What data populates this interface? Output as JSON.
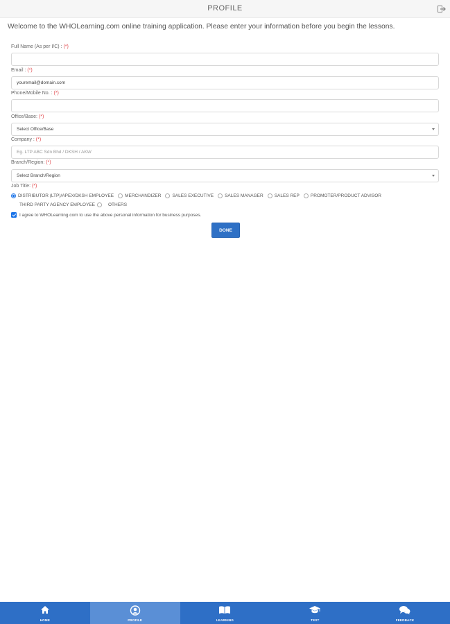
{
  "header": {
    "title": "PROFILE"
  },
  "welcome": "Welcome to the WHOLearning.com online training application. Please enter your information before you begin the lessons.",
  "form": {
    "fullname": {
      "label": "Full Name (As per I/C) : ",
      "req": "(*)",
      "value": ""
    },
    "email": {
      "label": "Email : ",
      "req": "(*)",
      "value": "youremail@domain.com"
    },
    "phone": {
      "label": "Phone/Mobile No. : ",
      "req": "(*)",
      "value": ""
    },
    "office": {
      "label": "Office/Base: ",
      "req": "(*)",
      "selected": "Select Office/Base"
    },
    "company": {
      "label": "Company : ",
      "req": "(*)",
      "placeholder": "Eg. LTP ABC Sdn Bhd / DKSH / AKW"
    },
    "branch": {
      "label": "Branch/Region: ",
      "req": "(*)",
      "selected": "Select Branch/Region"
    },
    "jobtitle": {
      "label": "Job Title: ",
      "req": "(*)",
      "options": [
        "DISTRIBUTOR (LTP)/APEX/DKSH EMPLOYEE",
        "MERCHANDIZER",
        "SALES EXECUTIVE",
        "SALES MANAGER",
        "SALES REP",
        "PROMOTER/PRODUCT ADVISOR",
        "THIRD PARTY AGENCY EMPLOYEE",
        "OTHERS"
      ],
      "selected_index": 0
    },
    "agree": {
      "label": "I agree to WHOLearning.com to use the above personal information for business purposes.",
      "checked": true
    },
    "done_label": "DONE"
  },
  "nav": {
    "items": [
      {
        "label": "HOME",
        "icon": "home-icon"
      },
      {
        "label": "PROFILE",
        "icon": "user-icon"
      },
      {
        "label": "LEARNING",
        "icon": "book-icon"
      },
      {
        "label": "TEST",
        "icon": "graduation-cap-icon"
      },
      {
        "label": "FEEDBACK",
        "icon": "chat-icon"
      }
    ],
    "active_index": 1
  },
  "colors": {
    "accent": "#2e70c5",
    "nav_bg": "#2e6fc6",
    "nav_active": "#5a8fd6",
    "required": "#e0464a"
  }
}
